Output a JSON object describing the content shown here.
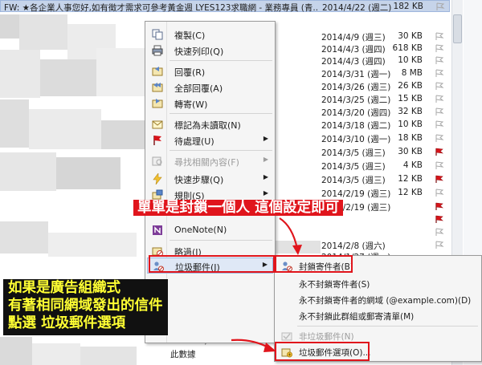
{
  "email_list": {
    "top_row": {
      "subject": "FW: ★各企業人事您好,如有徵才需求可參考黃金週 LYES123求職網 - 業務專員 (青...",
      "date": "2014/4/22 (週二)",
      "size": "182 KB"
    },
    "rows": [
      {
        "date": "2014/4/9 (週三)",
        "size": "30 KB",
        "flag": "outline"
      },
      {
        "date": "2014/4/3 (週四)",
        "size": "618 KB",
        "flag": "outline"
      },
      {
        "date": "2014/4/3 (週四)",
        "size": "10 KB",
        "flag": "outline"
      },
      {
        "date": "2014/3/31 (週一)",
        "size": "8 MB",
        "flag": "outline"
      },
      {
        "date": "2014/3/26 (週三)",
        "size": "26 KB",
        "flag": "outline"
      },
      {
        "date": "2014/3/25 (週二)",
        "size": "15 KB",
        "flag": "outline"
      },
      {
        "date": "2014/3/20 (週四)",
        "size": "32 KB",
        "flag": "outline"
      },
      {
        "date": "2014/3/18 (週二)",
        "size": "10 KB",
        "flag": "outline"
      },
      {
        "date": "2014/3/10 (週一)",
        "size": "18 KB",
        "flag": "outline"
      },
      {
        "date": "2014/3/5 (週三)",
        "size": "30 KB",
        "flag": "red"
      },
      {
        "date": "2014/3/5 (週三)",
        "size": "4 KB",
        "flag": "outline"
      },
      {
        "date": "2014/3/5 (週三)",
        "size": "12 KB",
        "flag": "red"
      },
      {
        "date": "2014/2/19 (週三)",
        "size": "12 KB",
        "flag": "outline"
      },
      {
        "date": "2014/2/19 (週三)",
        "size": "",
        "flag": "red"
      },
      {
        "date": "",
        "size": "",
        "flag": "red"
      },
      {
        "date": "",
        "size": "",
        "flag": "outline"
      },
      {
        "date": "2014/2/8 (週六)",
        "size": "",
        "flag": "outline"
      },
      {
        "date": "2014/1/27 (週一)",
        "size": "",
        "flag": "outline"
      }
    ],
    "bottom_fragment": "此數據",
    "bottom_fragment2": "DF)"
  },
  "context_menu": {
    "items": [
      {
        "label": "複製(C)",
        "icon": "copy-icon"
      },
      {
        "label": "快速列印(Q)",
        "icon": "print-icon"
      },
      {
        "label": "回覆(R)",
        "icon": "reply-icon"
      },
      {
        "label": "全部回覆(A)",
        "icon": "reply-all-icon"
      },
      {
        "label": "轉寄(W)",
        "icon": "forward-icon"
      },
      {
        "label": "標記為未讀取(N)",
        "icon": "mark-unread-icon"
      },
      {
        "label": "待處理(U)",
        "icon": "flag-icon",
        "submenu": true
      },
      {
        "label": "尋找相關內容(F)",
        "icon": "find-related-icon",
        "submenu": true,
        "disabled": true
      },
      {
        "label": "快速步驟(Q)",
        "icon": "quick-steps-icon",
        "submenu": true
      },
      {
        "label": "規則(S)",
        "icon": "rules-icon",
        "submenu": true
      },
      {
        "label": "OneNote(N)",
        "icon": "onenote-icon"
      },
      {
        "label": "略過(I)",
        "icon": "ignore-icon"
      },
      {
        "label": "垃圾郵件(J)",
        "icon": "junk-mail-icon",
        "submenu": true,
        "highlighted": true
      }
    ]
  },
  "submenu": {
    "items": [
      {
        "label": "封鎖寄件者(B)",
        "icon": "block-sender-icon"
      },
      {
        "label": "永不封鎖寄件者(S)",
        "icon": ""
      },
      {
        "label": "永不封鎖寄件者的網域 (@example.com)(D)",
        "icon": ""
      },
      {
        "label": "永不封鎖此群組或郵寄清單(M)",
        "icon": ""
      },
      {
        "label": "非垃圾郵件(N)",
        "icon": "not-junk-icon",
        "disabled": true
      },
      {
        "label": "垃圾郵件選項(O)...",
        "icon": "junk-options-icon"
      }
    ]
  },
  "annotations": {
    "top": "單單是封鎖一個人 這個設定即可",
    "bottom": [
      "如果是廣告組織式",
      "有著相同網域發出的信件",
      "點選 垃圾郵件選項"
    ]
  },
  "colors": {
    "annotation_red": "#e0151c",
    "annotation_yellow": "#ffff33",
    "selection_blue": "#c6d4ea",
    "flag_red": "#d7141a"
  }
}
